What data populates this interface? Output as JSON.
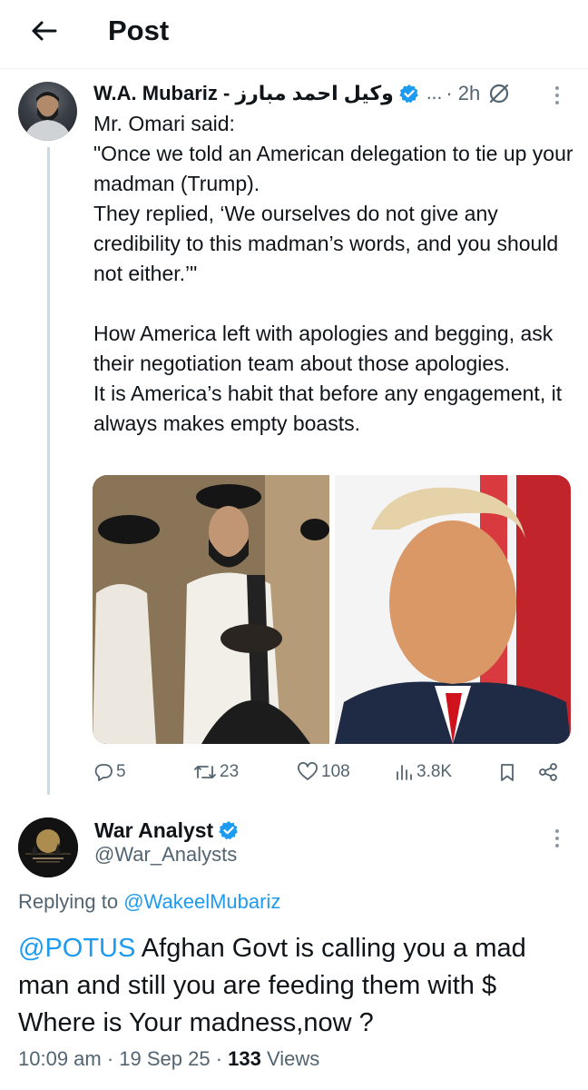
{
  "header": {
    "title": "Post"
  },
  "tweet": {
    "author_name": "W.A. Mubariz - وکیل احمد مبارز",
    "ellipsis": "...",
    "time": "· 2h",
    "paragraph1": [
      "Mr. Omari said:",
      "\"Once we told an American delegation to tie up your madman (Trump).",
      "They replied, ‘We ourselves do not give any credibility to this madman’s words, and you should not either.’\""
    ],
    "paragraph2": [
      "How America left with apologies and begging, ask their negotiation team about those apologies.",
      "It is America’s habit that before any engagement, it always makes empty boasts."
    ],
    "stats": {
      "replies": "5",
      "reposts": "23",
      "likes": "108",
      "views": "3.8K"
    }
  },
  "reply": {
    "author_name": "War Analyst",
    "handle": "@War_Analysts",
    "replying_label": "Replying to",
    "replying_to": "@WakeelMubariz",
    "mention": "@POTUS",
    "text": " Afghan Govt is calling you a mad man and still you are feeding them with $ Where is Your madness,now ?",
    "time": "10:09 am",
    "date": "19 Sep 25",
    "views_count": "133",
    "views_label": "Views"
  },
  "colors": {
    "accent": "#1d9bf0",
    "text": "#0f1419",
    "muted": "#536471",
    "line": "#cfd9de"
  }
}
